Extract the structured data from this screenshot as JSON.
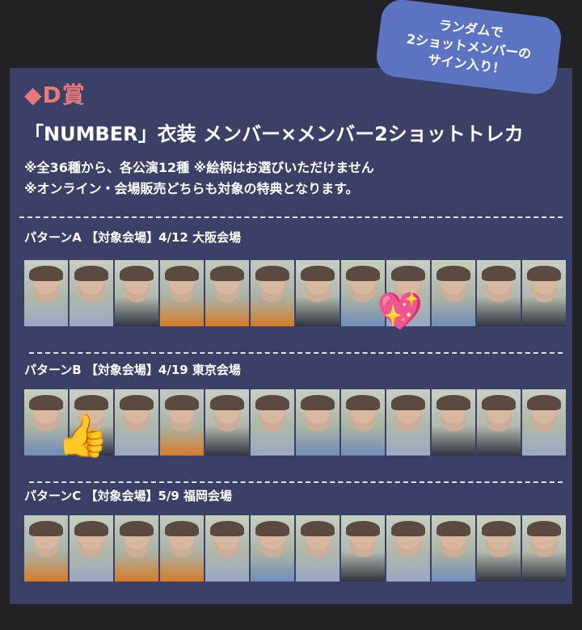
{
  "bubble": {
    "text": "ランダムで\n2ショットメンバーの\nサイン入り！"
  },
  "header": {
    "title": "◆D賞",
    "subtitle": "「NUMBER」衣装 メンバー×メンバー2ショットトレカ",
    "notes": [
      "※全36種から、各公演12種 ※絵柄はお選びいただけません",
      "※オンライン・会場販売どちらも対象の特典となります。"
    ]
  },
  "patterns": [
    {
      "label": "パターンA 【対象会場】4/12 大阪会場",
      "card_count": 12
    },
    {
      "label": "パターンB 【対象会場】4/19 東京会場",
      "card_count": 12
    },
    {
      "label": "パターンC 【対象会場】5/9 福岡会場",
      "card_count": 12
    }
  ],
  "stickers": [
    {
      "name": "sparkling-heart",
      "glyph": "💖"
    },
    {
      "name": "thumbs-up",
      "glyph": "👍"
    }
  ],
  "colors": {
    "background": "#222226",
    "panel": "#3b4166",
    "title": "#e57a7a",
    "bubble": "#5c73c2"
  }
}
